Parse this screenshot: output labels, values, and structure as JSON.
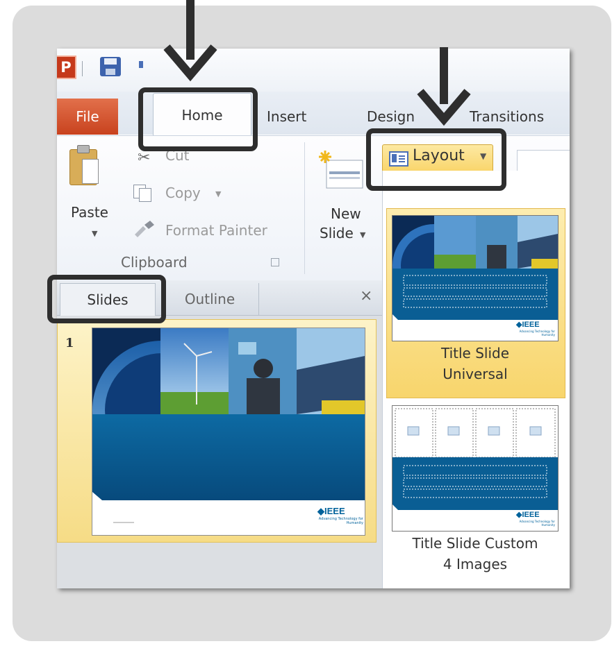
{
  "window": {
    "app_logo": "P",
    "tabs": {
      "file": "File",
      "home": "Home",
      "insert": "Insert",
      "design": "Design",
      "transitions": "Transitions"
    }
  },
  "ribbon": {
    "clipboard": {
      "paste_label": "Paste",
      "cut_label": "Cut",
      "copy_label": "Copy",
      "format_painter_label": "Format Painter",
      "group_label": "Clipboard"
    },
    "slides": {
      "new_slide_line1": "New",
      "new_slide_line2": "Slide",
      "layout_label": "Layout"
    }
  },
  "left_pane": {
    "tab_slides": "Slides",
    "tab_outline": "Outline",
    "close_glyph": "×",
    "slide_number": "1"
  },
  "slide_branding": {
    "logo_text": "◆IEEE",
    "tagline": "Advancing Technology for Humanity"
  },
  "layout_gallery": {
    "items": [
      {
        "line1": "Title Slide",
        "line2": "Universal"
      },
      {
        "line1": "Title Slide Custom",
        "line2": "4 Images"
      }
    ]
  },
  "icons": [
    "powerpoint-icon",
    "save-icon",
    "undo-icon",
    "paste-icon",
    "cut-icon",
    "copy-icon",
    "format-painter-icon",
    "new-slide-icon",
    "layout-icon",
    "close-icon",
    "dialog-launcher-icon"
  ],
  "colors": {
    "file_tab": "#c8421e",
    "highlight_gold": "#f9d56b",
    "slide_blue": "#0a5e94",
    "annotation": "#2e2e2e",
    "backdrop": "#dcdcdc"
  }
}
